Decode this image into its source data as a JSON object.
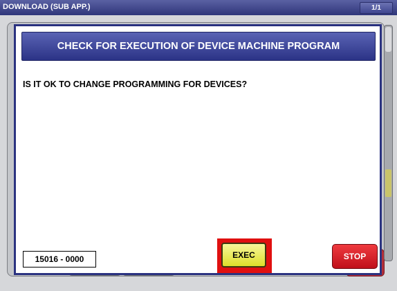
{
  "window": {
    "title": "DOWNLOAD (SUB APP.)",
    "page_indicator": "1/1"
  },
  "dialog": {
    "title": "CHECK FOR EXECUTION OF DEVICE MACHINE PROGRAM",
    "question": "IS IT OK TO CHANGE PROGRAMMING FOR DEVICES?",
    "code": "15016 - 0000",
    "exec_label": "EXEC",
    "stop_label": "STOP"
  },
  "colors": {
    "header_blue": "#2b3386",
    "exec_yellow": "#dede2a",
    "exec_highlight": "#e01010",
    "stop_red": "#c0101a"
  }
}
